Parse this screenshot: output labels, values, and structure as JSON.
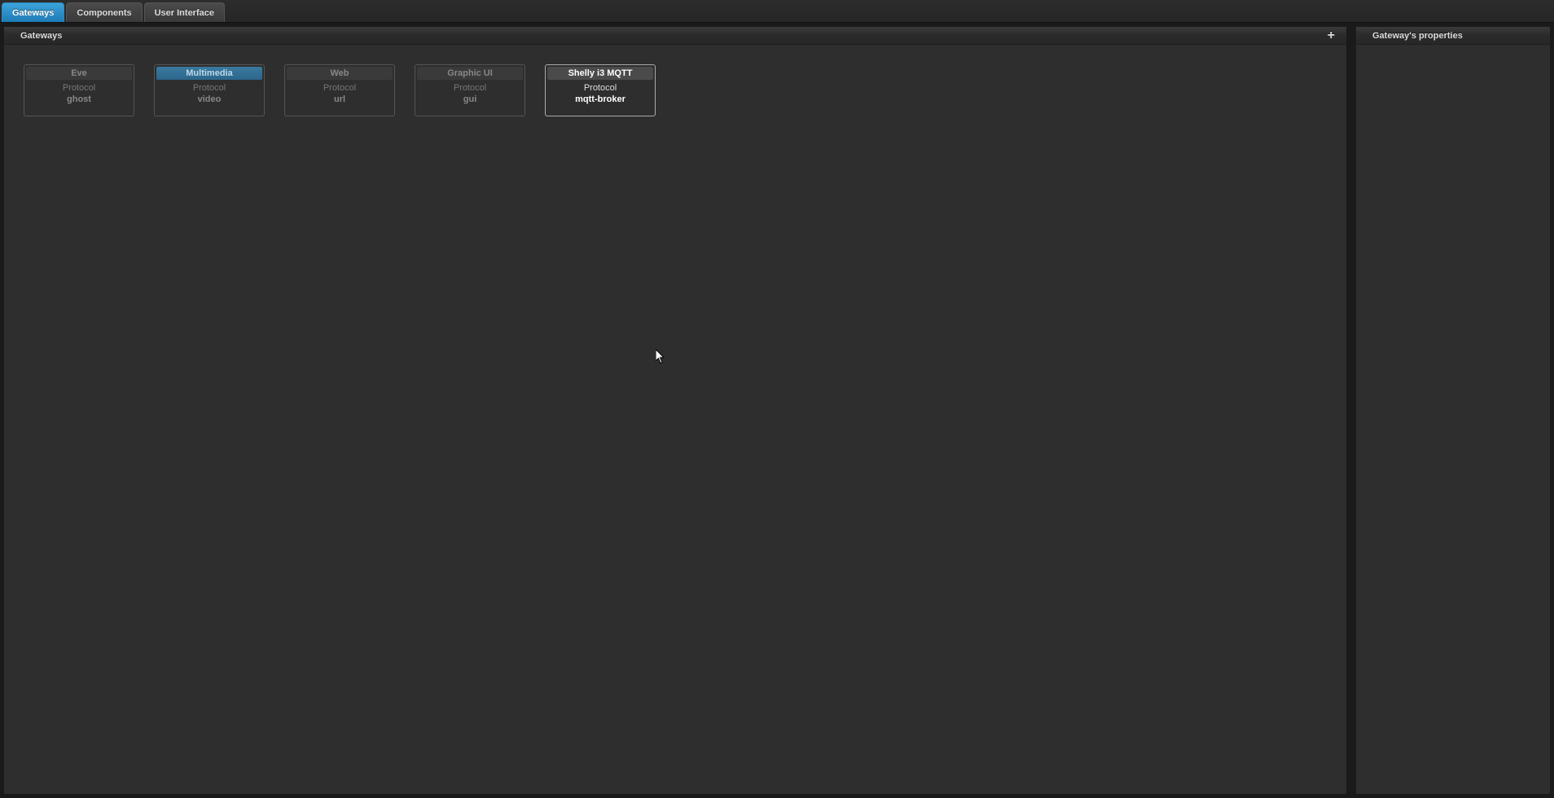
{
  "tabs": {
    "gateways": "Gateways",
    "components": "Components",
    "user_interface": "User Interface"
  },
  "panels": {
    "gateways_title": "Gateways",
    "properties_title": "Gateway's properties"
  },
  "icons": {
    "plus": "+"
  },
  "protocol_label": "Protocol",
  "gateways": [
    {
      "name": "Eve",
      "protocol": "ghost",
      "highlight": false,
      "selected": false
    },
    {
      "name": "Multimedia",
      "protocol": "video",
      "highlight": true,
      "selected": false
    },
    {
      "name": "Web",
      "protocol": "url",
      "highlight": false,
      "selected": false
    },
    {
      "name": "Graphic UI",
      "protocol": "gui",
      "highlight": false,
      "selected": false
    },
    {
      "name": "Shelly i3 MQTT",
      "protocol": "mqtt-broker",
      "highlight": false,
      "selected": true
    }
  ]
}
